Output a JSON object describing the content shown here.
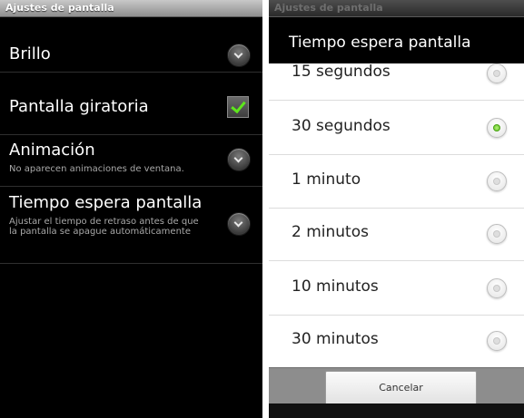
{
  "left_screen": {
    "title": "Ajustes de pantalla",
    "items": [
      {
        "label": "Brillo",
        "control": "chevron-down-icon"
      },
      {
        "label": "Pantalla giratoria",
        "control": "checkbox",
        "checked": true
      },
      {
        "label": "Animación",
        "summary": "No aparecen animaciones de ventana.",
        "control": "chevron-down-icon"
      },
      {
        "label": "Tiempo espera pantalla",
        "summary": "Ajustar el tiempo de retraso antes de que la pantalla se apague automáticamente",
        "control": "chevron-down-icon"
      }
    ]
  },
  "right_screen": {
    "title": "Ajustes de pantalla",
    "dialog": {
      "title": "Tiempo espera pantalla",
      "options": [
        {
          "label": "15 segundos",
          "selected": false
        },
        {
          "label": "30 segundos",
          "selected": true
        },
        {
          "label": "1 minuto",
          "selected": false
        },
        {
          "label": "2 minutos",
          "selected": false
        },
        {
          "label": "10 minutos",
          "selected": false
        },
        {
          "label": "30 minutos",
          "selected": false
        }
      ],
      "cancel_label": "Cancelar"
    }
  },
  "colors": {
    "accent_green": "#5ee61c",
    "radio_selected": "#5ec41e"
  }
}
